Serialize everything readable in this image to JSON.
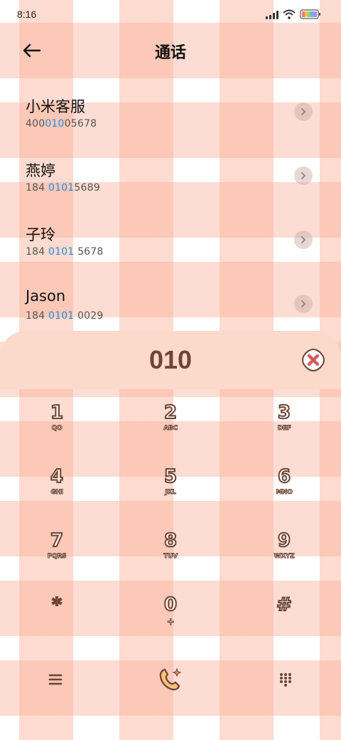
{
  "status_bar": {
    "time": "8:16"
  },
  "header": {
    "title": "通话"
  },
  "contacts": [
    {
      "name": "小米客服",
      "num_pre": "400",
      "num_hl": "010",
      "num_post": "05678"
    },
    {
      "name": "燕婷",
      "num_pre": "184 ",
      "num_hl": "0101",
      "num_post": "5689"
    },
    {
      "name": "子玲",
      "num_pre": "184 ",
      "num_hl": "0101",
      "num_post": " 5678"
    },
    {
      "name": "Jason",
      "num_pre": "184 ",
      "num_hl": "0101",
      "num_post": " 0029"
    }
  ],
  "dialer": {
    "digits": "010",
    "keys": [
      {
        "digit": "1",
        "letters": "QO"
      },
      {
        "digit": "2",
        "letters": "ABC"
      },
      {
        "digit": "3",
        "letters": "DEF"
      },
      {
        "digit": "4",
        "letters": "GHI"
      },
      {
        "digit": "5",
        "letters": "JKL"
      },
      {
        "digit": "6",
        "letters": "MNO"
      },
      {
        "digit": "7",
        "letters": "PQRS"
      },
      {
        "digit": "8",
        "letters": "TUV"
      },
      {
        "digit": "9",
        "letters": "WXYZ"
      },
      {
        "digit": "*",
        "letters": ""
      },
      {
        "digit": "0",
        "letters": "+"
      },
      {
        "digit": "#",
        "letters": ""
      }
    ]
  },
  "colors": {
    "accent_blue": "#2a8ad8",
    "brown": "#6b4335",
    "dialer_bar": "#fbd9cb"
  },
  "icons": [
    "back-arrow-icon",
    "chevron-right-icon",
    "delete-icon",
    "menu-icon",
    "call-icon",
    "keypad-grid-icon",
    "signal-icon",
    "wifi-icon",
    "battery-icon"
  ]
}
